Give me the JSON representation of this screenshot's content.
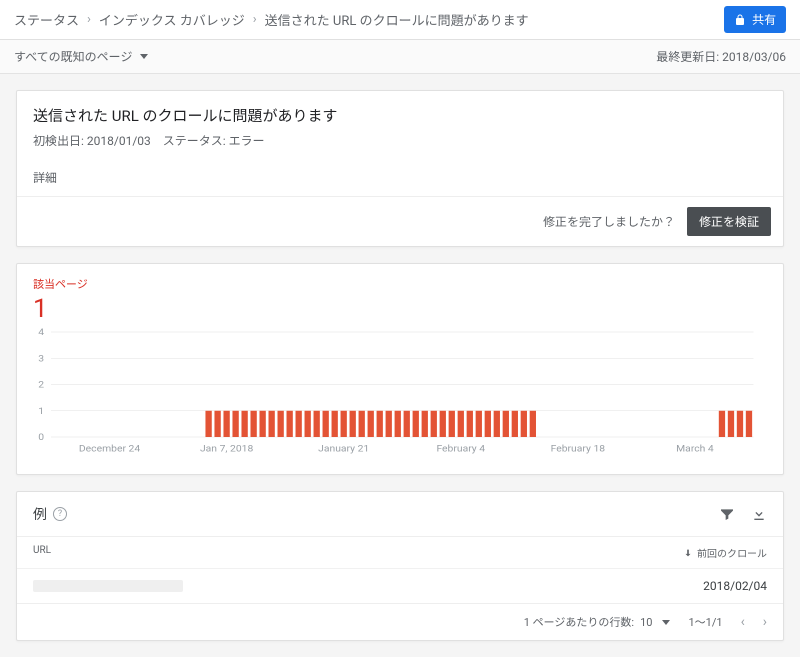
{
  "breadcrumb": {
    "items": [
      "ステータス",
      "インデックス カバレッジ",
      "送信された URL のクロールに問題があります"
    ]
  },
  "share": {
    "label": "共有"
  },
  "subbar": {
    "filter_label": "すべての既知のページ",
    "last_updated_label": "最終更新日:",
    "last_updated_value": "2018/03/06"
  },
  "issue": {
    "title": "送信された URL のクロールに問題があります",
    "first_detected_label": "初検出日:",
    "first_detected_value": "2018/01/03",
    "status_label": "ステータス:",
    "status_value": "エラー",
    "details_label": "詳細",
    "done_fixing_label": "修正を完了しましたか？",
    "validate_label": "修正を検証"
  },
  "chart_data": {
    "type": "bar",
    "title": "該当ページ",
    "count": "1",
    "ylim": [
      0,
      4
    ],
    "yticks": [
      0,
      1,
      2,
      3,
      4
    ],
    "xticks": [
      "December 24",
      "Jan 7, 2018",
      "January 21",
      "February 4",
      "February 18",
      "March 4"
    ],
    "series": [
      {
        "name": "該当ページ",
        "start_date": "2017-12-17",
        "values": [
          0,
          0,
          0,
          0,
          0,
          0,
          0,
          0,
          0,
          0,
          0,
          0,
          0,
          0,
          0,
          0,
          0,
          1,
          1,
          1,
          1,
          1,
          1,
          1,
          1,
          1,
          1,
          1,
          1,
          1,
          1,
          1,
          1,
          1,
          1,
          1,
          1,
          1,
          1,
          1,
          1,
          1,
          1,
          1,
          1,
          1,
          1,
          1,
          1,
          1,
          1,
          1,
          1,
          1,
          0,
          0,
          0,
          0,
          0,
          0,
          0,
          0,
          0,
          0,
          0,
          0,
          0,
          0,
          0,
          0,
          0,
          0,
          0,
          0,
          1,
          1,
          1,
          1
        ]
      }
    ]
  },
  "table": {
    "title": "例",
    "cols": {
      "url": "URL",
      "last_crawl": "前回のクロール"
    },
    "rows": [
      {
        "url": "",
        "last_crawl": "2018/02/04"
      }
    ],
    "footer": {
      "rows_per_page_label": "1 ページあたりの行数:",
      "rows_per_page_value": "10",
      "range": "1～1/1"
    }
  }
}
